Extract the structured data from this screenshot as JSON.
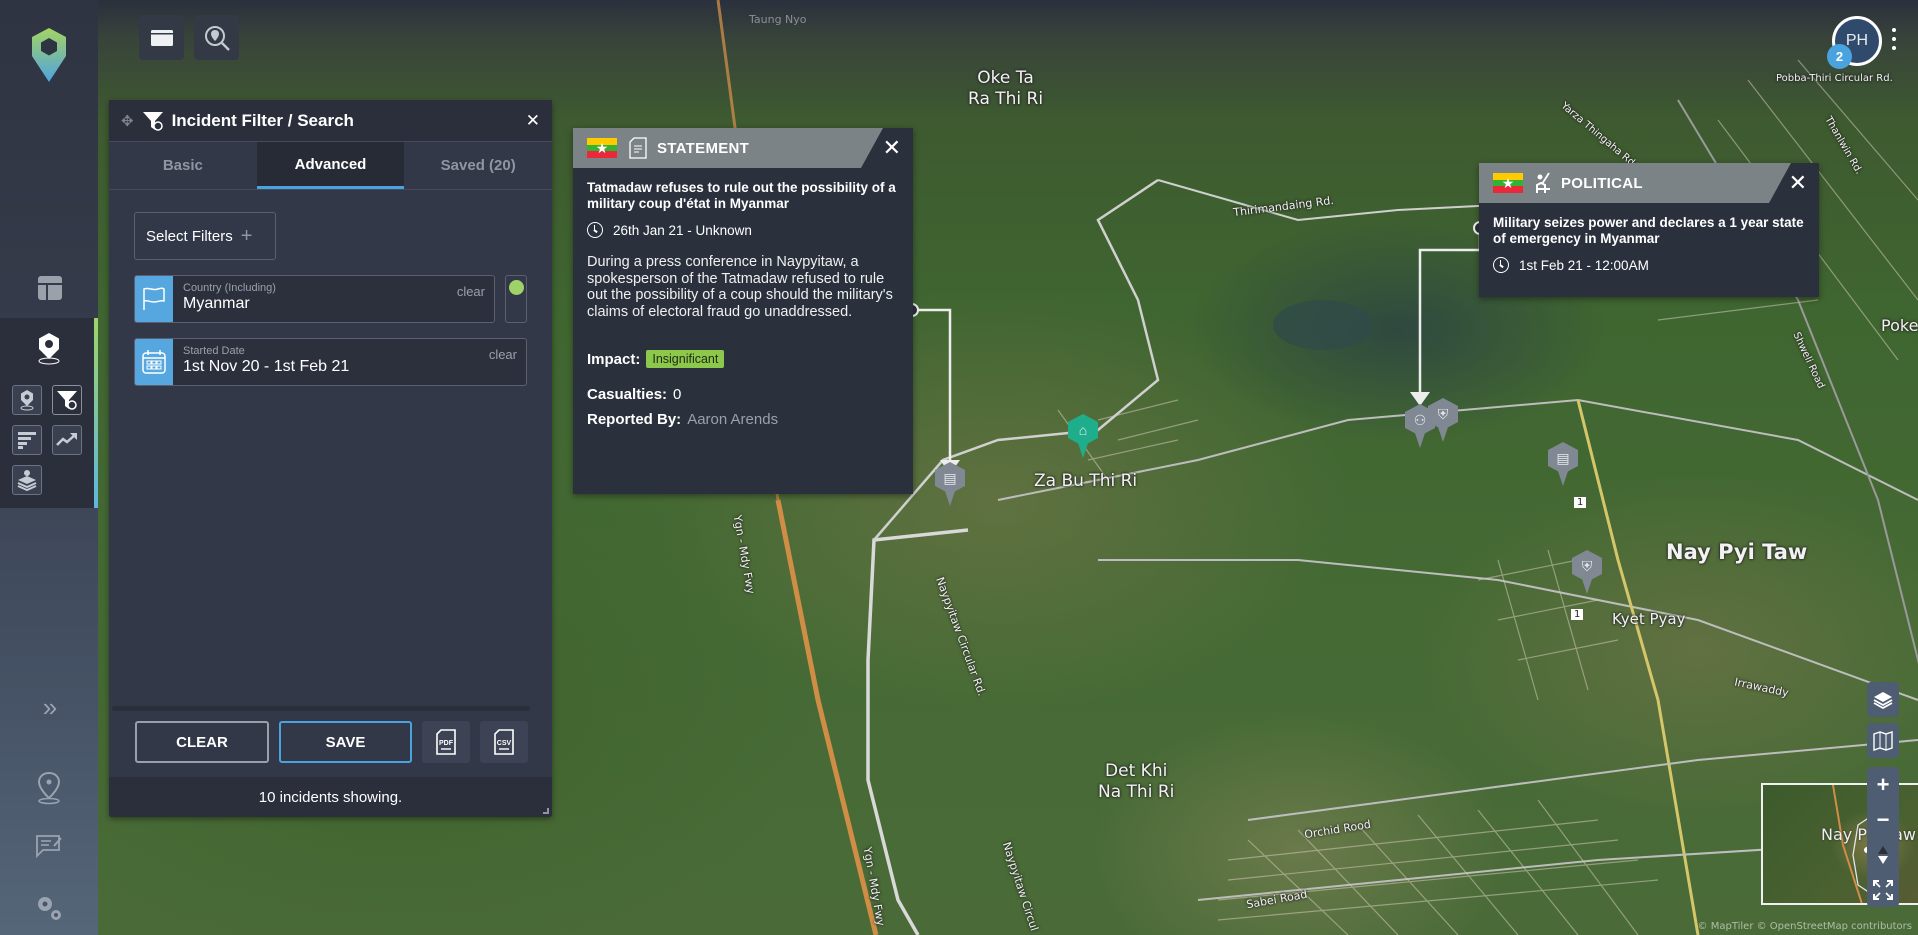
{
  "nav": {
    "logo": "app-logo-hex-pin",
    "items": [
      {
        "name": "dashboard",
        "icon": "layout-icon"
      },
      {
        "name": "incidents",
        "icon": "hex-pin-icon"
      },
      {
        "name": "incident-pins",
        "icon": "pin-icon"
      },
      {
        "name": "incident-filter",
        "icon": "filter-gear-icon"
      },
      {
        "name": "bar-list",
        "icon": "bar-list-icon"
      },
      {
        "name": "trend",
        "icon": "trend-up-icon"
      },
      {
        "name": "layers-pin",
        "icon": "layers-pin-icon"
      },
      {
        "name": "expand",
        "icon": "double-chevron-right-icon",
        "glyph": "»"
      },
      {
        "name": "locations",
        "icon": "location-pin-icon"
      },
      {
        "name": "feedback",
        "icon": "chat-edit-icon"
      },
      {
        "name": "settings",
        "icon": "gears-icon"
      }
    ]
  },
  "toolbar": {
    "buttons": [
      {
        "name": "window-toggle",
        "icon": "window-icon"
      },
      {
        "name": "location-search",
        "icon": "location-search-icon"
      }
    ]
  },
  "filter_panel": {
    "title": "Incident Filter / Search",
    "close_glyph": "✕",
    "move_glyph": "✥",
    "tabs": [
      {
        "label": "Basic",
        "active": false
      },
      {
        "label": "Advanced",
        "active": true
      },
      {
        "label": "Saved (20)",
        "active": false
      }
    ],
    "select_filters_label": "Select Filters",
    "select_filters_plus": "+",
    "filters": [
      {
        "label": "Country (Including)",
        "value": "Myanmar",
        "clear": "clear",
        "icon": "flag-icon"
      },
      {
        "label": "Started Date",
        "value": "1st Nov 20 - 1st Feb 21",
        "clear": "clear",
        "icon": "calendar-icon"
      }
    ],
    "country_toggle_color": "#9fd36a",
    "buttons": {
      "clear": "CLEAR",
      "save": "SAVE",
      "pdf": "PDF",
      "csv": "CSV"
    },
    "footer": "10 incidents showing."
  },
  "popups": [
    {
      "category": "STATEMENT",
      "category_icon": "document-icon",
      "flag": "myanmar-flag",
      "headline": "Tatmadaw refuses to rule out the possibility of a military coup d'état in Myanmar",
      "time": "26th Jan 21 - Unknown",
      "description": "During a press conference in Naypyitaw, a spokesperson of the Tatmadaw refused to rule out the possibility of a coup should the military's claims of electoral fraud go unaddressed.",
      "impact_label": "Impact:",
      "impact": "Insignificant",
      "impact_color": "#8cc84b",
      "casualties_label": "Casualties:",
      "casualties": "0",
      "reported_label": "Reported By:",
      "reported_by": "Aaron Arends"
    },
    {
      "category": "POLITICAL",
      "category_icon": "podium-speaker-icon",
      "flag": "myanmar-flag",
      "headline": "Military seizes power and declares a 1 year state of emergency in Myanmar",
      "time": "1st Feb 21 - 12:00AM"
    }
  ],
  "map": {
    "labels": {
      "taung_nyo": "Taung Nyo",
      "oke_ta": "Oke Ta\nRa Thi Ri",
      "za_bu": "Za Bu Thi Ri",
      "nay_pyi_taw": "Nay Pyi Taw",
      "kyet_pyay": "Kyet Pyay",
      "det_khi": "Det Khi\nNa Thi Ri",
      "poke": "Poke",
      "thirimandaing": "Thirimandaing Rd.",
      "pobba": "Pobba-Thiri Circular Rd.",
      "yarza": "Yarza Thingaha Rd.",
      "shweli": "Shweli Road",
      "thanlwin": "Thanlwin Rd.",
      "irrawaddy": "Irrawaddy",
      "orchid": "Orchid Rood",
      "sabei": "Sabei Road",
      "ygn_mdy_1": "Ygn - Mdy Fwy",
      "ygn_mdy_2": "Ygn - Mdy Fwy",
      "circular_1": "Naypyitaw Circular Rd.",
      "circular_2": "Naypyitaw Circul",
      "route_1": "1"
    },
    "minimap_label": "Nay Pyi Taw",
    "attribution": "© MapTiler © OpenStreetMap contributors"
  },
  "user": {
    "initials": "PH",
    "notifications": "2"
  },
  "map_controls": {
    "layers": "layers-icon",
    "basemap": "map-icon",
    "zoom_in": "+",
    "zoom_out": "−",
    "compass": "compass-icon",
    "fullscreen": "fullscreen-icon"
  }
}
